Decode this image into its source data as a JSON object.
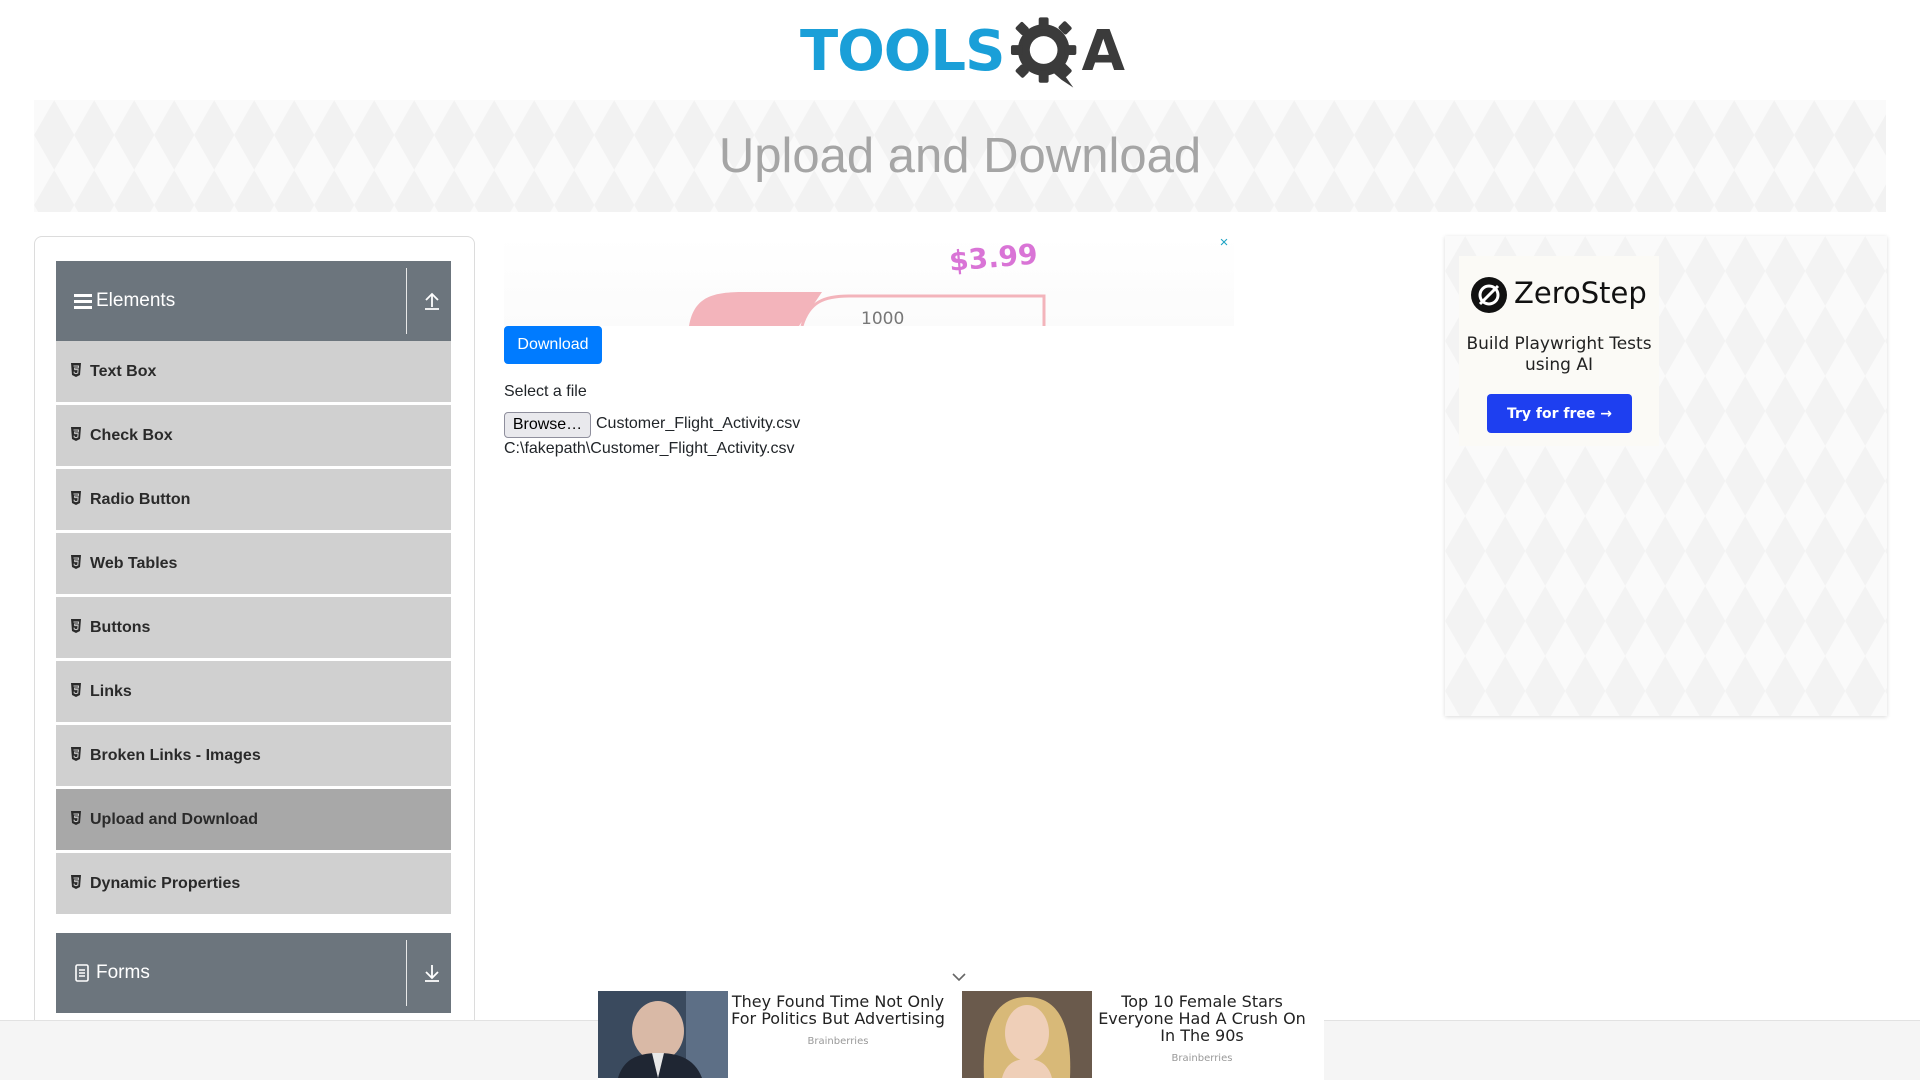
{
  "header": {
    "logo_text": "TOOLS",
    "logo_q_a": "A"
  },
  "banner": {
    "title": "Upload and Download"
  },
  "sidebar": {
    "elements_group": {
      "title": "Elements"
    },
    "items": [
      {
        "label": "Text Box"
      },
      {
        "label": "Check Box"
      },
      {
        "label": "Radio Button"
      },
      {
        "label": "Web Tables"
      },
      {
        "label": "Buttons"
      },
      {
        "label": "Links"
      },
      {
        "label": "Broken Links - Images"
      },
      {
        "label": "Upload and Download",
        "active": true
      },
      {
        "label": "Dynamic Properties"
      }
    ],
    "forms_group": {
      "title": "Forms"
    }
  },
  "main": {
    "download_label": "Download",
    "select_label": "Select a file",
    "browse_label": "Browse…",
    "file_name": "Customer_Flight_Activity.csv",
    "file_path": "C:\\fakepath\\Customer_Flight_Activity.csv",
    "ad_close": "×",
    "ad_price": "$3.99",
    "ad_number": "1000"
  },
  "right_ad": {
    "brand": "ZeroStep",
    "tagline": "Build Playwright Tests using AI",
    "cta": "Try for free →"
  },
  "bottom_ad": {
    "items": [
      {
        "title": "They Found Time Not Only For Politics But Advertising",
        "source": "Brainberries"
      },
      {
        "title": "Top 10 Female Stars Everyone Had A Crush On In The 90s",
        "source": "Brainberries"
      }
    ]
  },
  "colors": {
    "primary": "#007bff",
    "sidebar_header": "#6c757d",
    "menu_item": "#d0d0d0",
    "menu_active": "#a8a8a8",
    "logo_blue": "#1a9fd8"
  }
}
